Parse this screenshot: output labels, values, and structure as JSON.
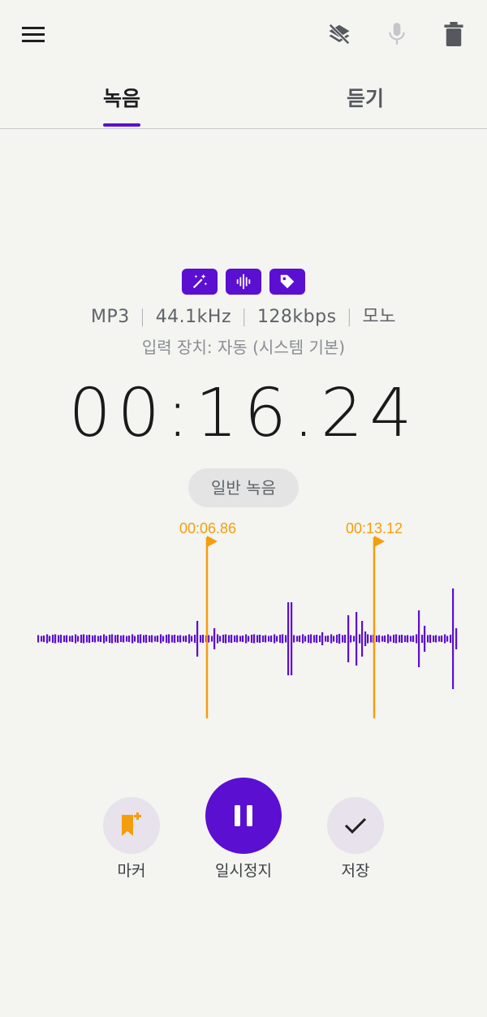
{
  "header": {
    "icons": [
      "menu-icon",
      "layers-off-icon",
      "mic-icon",
      "trash-icon"
    ]
  },
  "tabs": [
    {
      "label": "녹음",
      "active": true
    },
    {
      "label": "듣기",
      "active": false
    }
  ],
  "badges": [
    "magic-wand-icon",
    "waveform-icon",
    "tag-icon"
  ],
  "recording": {
    "format": "MP3",
    "sample_rate": "44.1kHz",
    "bitrate": "128kbps",
    "channels": "모노",
    "input_device": "입력 장치: 자동 (시스템 기본)",
    "timer": "00:16.24",
    "mode": "일반 녹음"
  },
  "markers": [
    {
      "time": "00:06.86"
    },
    {
      "time": "00:13.12"
    }
  ],
  "controls": {
    "marker_label": "마커",
    "pause_label": "일시정지",
    "save_label": "저장"
  },
  "colors": {
    "accent": "#5b0fd1",
    "marker": "#f59e0b",
    "background": "#f4f4f1"
  }
}
